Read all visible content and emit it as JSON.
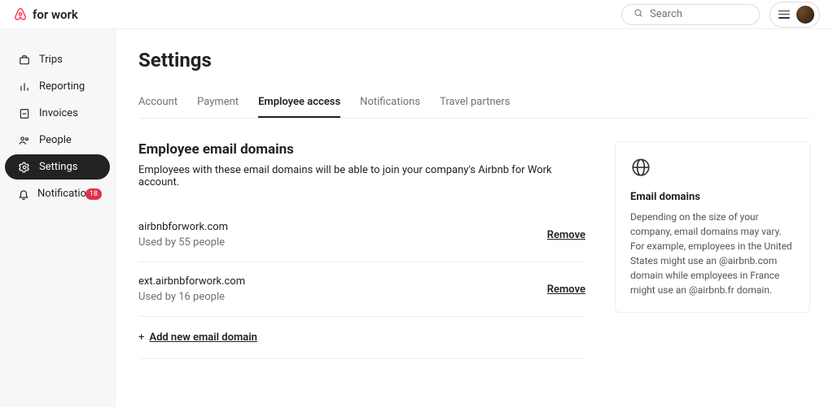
{
  "header": {
    "brand_text": "for work",
    "search_placeholder": "Search"
  },
  "sidebar": {
    "items": [
      {
        "label": "Trips"
      },
      {
        "label": "Reporting"
      },
      {
        "label": "Invoices"
      },
      {
        "label": "People"
      },
      {
        "label": "Settings"
      },
      {
        "label": "Notifications",
        "badge": "18"
      }
    ]
  },
  "page": {
    "title": "Settings",
    "tabs": [
      {
        "label": "Account"
      },
      {
        "label": "Payment"
      },
      {
        "label": "Employee access"
      },
      {
        "label": "Notifications"
      },
      {
        "label": "Travel partners"
      }
    ]
  },
  "section": {
    "title": "Employee email domains",
    "description": "Employees with these email domains will be able to join your company's Airbnb for Work account."
  },
  "domains": [
    {
      "name": "airbnbforwork.com",
      "usage": "Used by 55 people",
      "action": "Remove"
    },
    {
      "name": "ext.airbnbforwork.com",
      "usage": "Used by 16 people",
      "action": "Remove"
    }
  ],
  "add_action": {
    "plus": "+",
    "label": "Add new email domain"
  },
  "info_card": {
    "title": "Email domains",
    "body": "Depending on the size of your company, email domains may vary. For example, employees in the United States might use an @airbnb.com domain while employees in France might use an @airbnb.fr domain."
  }
}
